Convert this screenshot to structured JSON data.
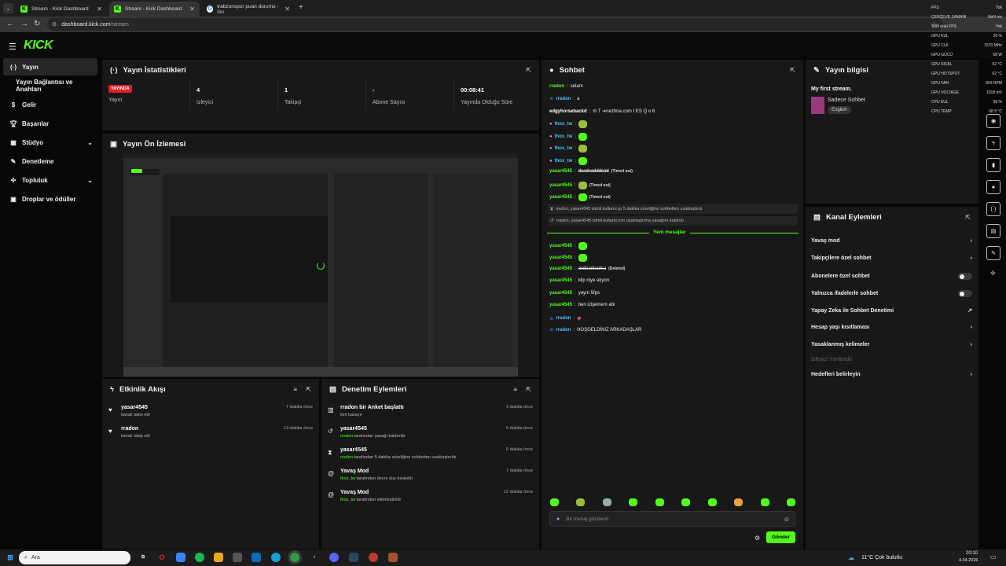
{
  "browser": {
    "tabs": [
      {
        "title": "Stream - Kick Dashboard"
      },
      {
        "title": "Stream - Kick Dashboard"
      },
      {
        "title": "trabzonspor puan durumu - Go"
      }
    ],
    "url_domain": "dashboard.kick.com",
    "url_path": "/stream"
  },
  "app": {
    "logo": "KICK"
  },
  "sidebar": {
    "items": [
      {
        "label": "Yayın",
        "icon": "broadcast-icon"
      },
      {
        "label": "Yayın Bağlantısı ve Anahtarı",
        "icon": ""
      },
      {
        "label": "Gelir",
        "icon": "dollar-icon"
      },
      {
        "label": "Başarılar",
        "icon": "trophy-icon"
      },
      {
        "label": "Stüdyo",
        "icon": "studio-icon"
      },
      {
        "label": "Denetleme",
        "icon": "wrench-icon"
      },
      {
        "label": "Topluluk",
        "icon": "community-icon"
      },
      {
        "label": "Droplar ve ödüller",
        "icon": "gift-icon"
      }
    ]
  },
  "stats": {
    "title": "Yayın İstatistikleri",
    "live_badge": "YAYINDA",
    "items": [
      {
        "label": "Yayın",
        "value": ""
      },
      {
        "label": "İzleyici",
        "value": "4"
      },
      {
        "label": "Takipçi",
        "value": "1"
      },
      {
        "label": "Abone Sayısı",
        "value": "-"
      },
      {
        "label": "Yayında Olduğu Süre",
        "value": "00:08:41"
      }
    ]
  },
  "preview": {
    "title": "Yayın Ön İzlemesi"
  },
  "activity": {
    "title": "Etkinlik Akışı",
    "items": [
      {
        "name": "yasar4545",
        "desc": "kanalı takip etti",
        "time": "7 dakika önce"
      },
      {
        "name": "rradon",
        "desc": "kanalı takip etti",
        "time": "13 dakika önce"
      }
    ]
  },
  "moderation": {
    "title": "Denetim Eylemleri",
    "items": [
      {
        "name": "rradon bir Anket başlattı",
        "actor": "",
        "desc": "kim kazayır",
        "time": "3 dakika önce"
      },
      {
        "name": "yasar4545",
        "actor": "rradon",
        "desc": " tarafından yasağı kaldırıldı",
        "time": "6 dakika önce"
      },
      {
        "name": "yasar4545",
        "actor": "rradon",
        "desc": " tarafından 5 dakika süreliğine sohbetten uzaklaştırıldı",
        "time": "6 dakika önce"
      },
      {
        "name": "Yavaş Mod",
        "actor": "thox_tw",
        "desc": " tarafından devre dışı bırakıldı",
        "time": "7 dakika önce"
      },
      {
        "name": "Yavaş Mod",
        "actor": "thox_tw",
        "desc": " tarafından etkinleştirildi",
        "time": "12 dakika önce"
      }
    ]
  },
  "chat": {
    "title": "Sohbet",
    "messages": [
      {
        "user": "rradon",
        "text": "selam"
      },
      {
        "user": "rradon",
        "text": "a"
      },
      {
        "user": "edgyhorsebackd",
        "text": "m T ➜nezhna.com I ES Q o 6"
      },
      {
        "user": "thox_tw",
        "text": ""
      },
      {
        "user": "thox_tw",
        "text": ""
      },
      {
        "user": "thox_tw",
        "text": ""
      },
      {
        "user": "thox_tw",
        "text": ""
      },
      {
        "user": "yasar4545",
        "text": "dsadsadddsad",
        "tag": "(Timed out)"
      },
      {
        "user": "yasar4545",
        "text": "",
        "tag": "(Timed out)"
      },
      {
        "user": "yasar4545",
        "text": "",
        "tag": "(Timed out)"
      },
      {
        "user": "yasar4545",
        "text": "",
        "tag": ""
      },
      {
        "user": "yasar4545",
        "text": "",
        "tag": ""
      },
      {
        "user": "yasar4545",
        "text": "asdsadsadsa",
        "tag": "(Deleted)"
      },
      {
        "user": "yasar4545",
        "text": "klip niye alıyon",
        "tag": ""
      },
      {
        "user": "yasar4545",
        "text": "yayın 5fps",
        "tag": ""
      },
      {
        "user": "yasar4545",
        "text": "ben izlşemem abi",
        "tag": ""
      },
      {
        "user": "rradon",
        "text": "",
        "tag": ""
      },
      {
        "user": "rradon",
        "text": "HOŞGELDİNİZ ARKADAŞLAR",
        "tag": ""
      }
    ],
    "system": [
      {
        "text": "rradon, yasar4545 isimli kullanıcıyı 5 dakika süreliğine sohbetten uzaklaştırdı"
      },
      {
        "text": "rradon, yasar4545 isimli kullanıcının uzaklaştırma yasağını kaldırdı"
      }
    ],
    "new_messages": "Yeni mesajlar",
    "input_placeholder": "Bir mesaj gönderin",
    "send_label": "Gönder"
  },
  "stream_info": {
    "title": "Yayın bilgisi",
    "stream_title": "My first stream.",
    "category": "Sadece Sohbet",
    "language": "English"
  },
  "channel_actions": {
    "title": "Kanal Eylemleri",
    "items": [
      {
        "label": "Yavaş mod",
        "control": "chevron"
      },
      {
        "label": "Takipçilere özel sohbet",
        "control": "chevron"
      },
      {
        "label": "Abonelere özel sohbet",
        "control": "toggle"
      },
      {
        "label": "Yalnızca ifadelerle sohbet",
        "control": "toggle"
      },
      {
        "label": "Yapay Zeka ile Sohbet Denetimi",
        "control": "external"
      },
      {
        "label": "Hesap yaşı kısıtlaması",
        "control": "chevron"
      },
      {
        "label": "Yasaklanmış kelimeler",
        "control": "chevron"
      },
      {
        "label": "İzleyici Yönlendir",
        "control": "none"
      },
      {
        "label": "Hedefleri belirleyin",
        "control": "chevron"
      }
    ]
  },
  "overlay": {
    "rows": [
      {
        "k": "FPS",
        "v": "Yok"
      },
      {
        "k": "ÇERÇEVE ZAMANI",
        "v": "NaN ms"
      },
      {
        "k": "%99 ünlü FPS",
        "v": "Yok"
      },
      {
        "k": "GPU KUL",
        "v": "26 %"
      },
      {
        "k": "GPU CLK",
        "v": "1570 MHz"
      },
      {
        "k": "GPU GÜCÜ",
        "v": "58 W"
      },
      {
        "k": "GPU SICKL",
        "v": "62 °C"
      },
      {
        "k": "GPU HOTSPOT",
        "v": "62 °C"
      },
      {
        "k": "GPU FAN",
        "v": "803 RPM"
      },
      {
        "k": "GPU VOLTAGE",
        "v": "1018 mV"
      },
      {
        "k": "CPU KUL",
        "v": "99 %"
      },
      {
        "k": "CPU TEMP",
        "v": "68.9 °C"
      }
    ]
  },
  "taskbar": {
    "search": "Ara",
    "weather": "11°C  Çok bulutlu",
    "time": "20:10",
    "date": "4.04.2026"
  },
  "colors": {
    "accent": "#53fc18",
    "live": "#e11d2e",
    "panel": "#181818"
  }
}
